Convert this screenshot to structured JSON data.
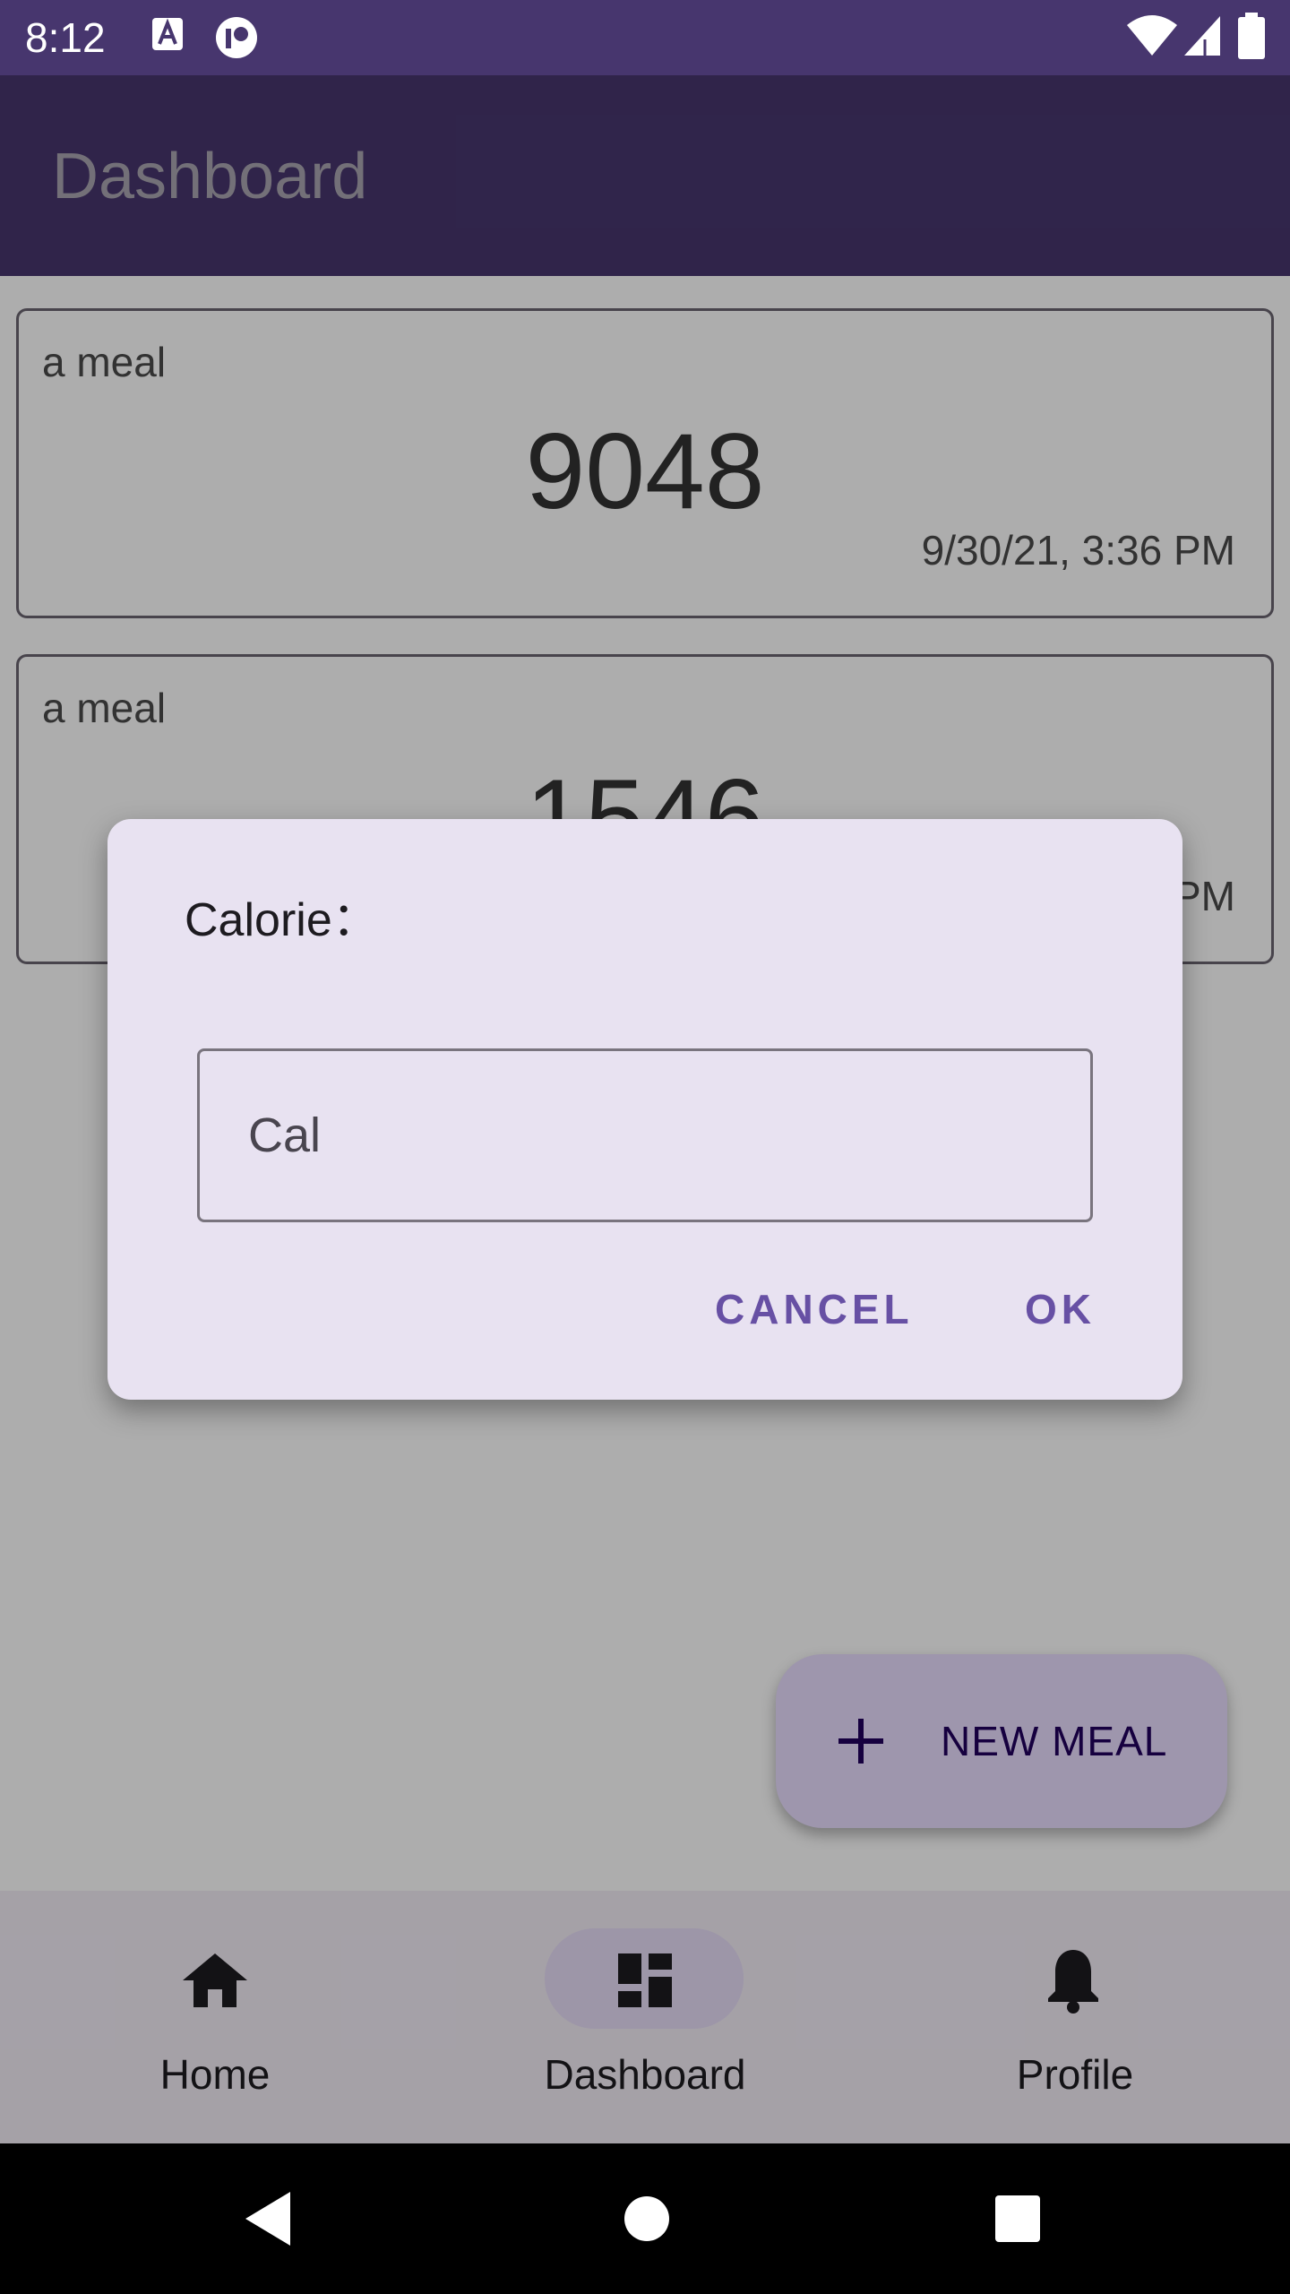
{
  "status_bar": {
    "time": "8:12",
    "left_icons": [
      "font-a-icon",
      "app-circle-icon"
    ],
    "right_icons": [
      "wifi-icon",
      "cellular-signal-icon",
      "battery-icon"
    ]
  },
  "app_bar": {
    "title": "Dashboard"
  },
  "meals": [
    {
      "name": "a meal",
      "calories": "9048",
      "datetime": "9/30/21, 3:36 PM"
    },
    {
      "name": "a meal",
      "calories": "1546",
      "datetime": "PM"
    }
  ],
  "fab": {
    "label": "NEW MEAL",
    "icon": "plus-icon"
  },
  "bottom_nav": {
    "items": [
      {
        "label": "Home",
        "icon": "home-icon",
        "selected": false
      },
      {
        "label": "Dashboard",
        "icon": "dashboard-icon",
        "selected": true
      },
      {
        "label": "Profile",
        "icon": "bell-icon",
        "selected": false
      }
    ]
  },
  "dialog": {
    "title": "Calorie：",
    "input_placeholder": "Cal",
    "cancel_label": "CANCEL",
    "ok_label": "OK"
  },
  "system_nav": {
    "icons": [
      "back-icon",
      "home-circle-icon",
      "recents-icon"
    ]
  },
  "colors": {
    "primary": "#47366e",
    "accent": "#6750a4",
    "surface": "#e8e2f1",
    "fab": "#e9ddff",
    "nav_bg": "#f3edf7",
    "nav_selected": "#e8def8"
  }
}
